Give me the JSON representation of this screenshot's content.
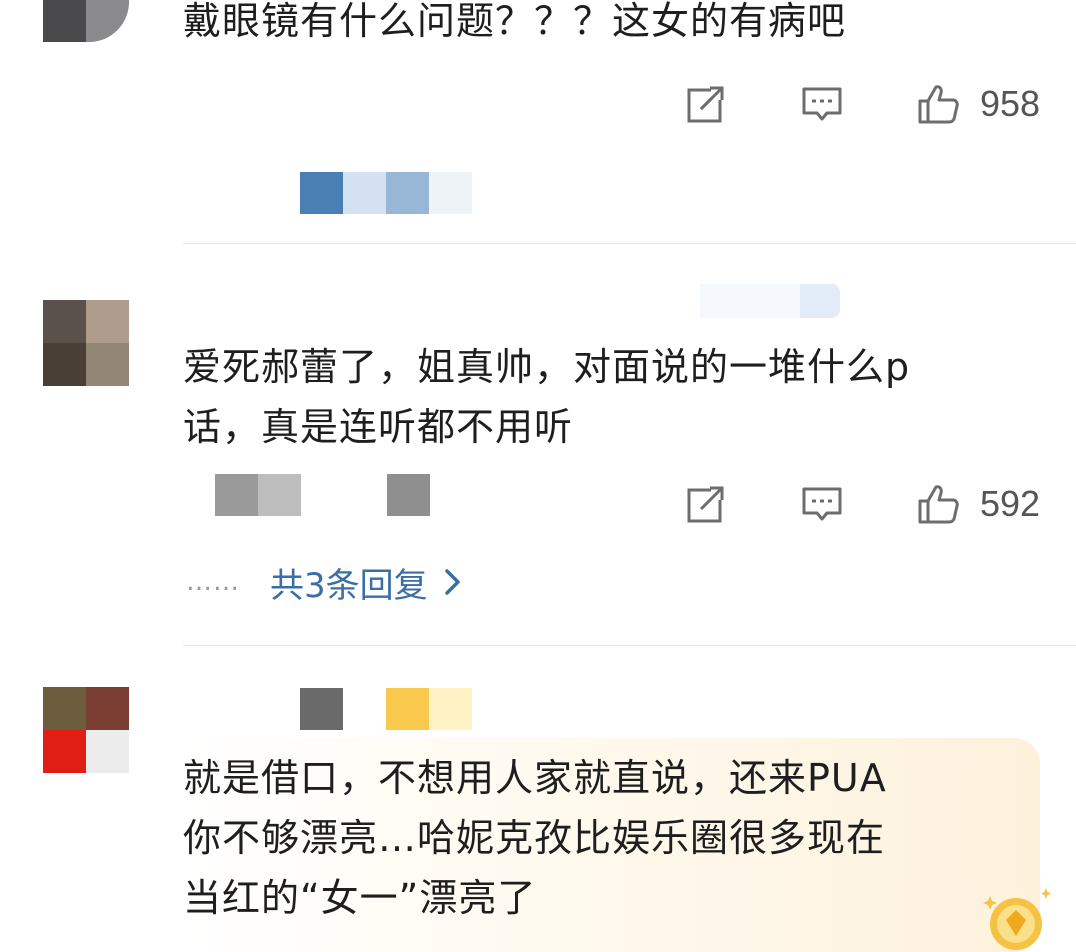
{
  "comments": [
    {
      "text": "戴眼镜有什么问题？？？这女的有病吧",
      "likes": "958"
    },
    {
      "text_line1": "爱死郝蕾了，姐真帅，对面说的一堆什么p",
      "text_line2": "话，真是连听都不用听",
      "likes": "592",
      "replies": {
        "dots": "……",
        "label": "共3条回复"
      }
    },
    {
      "text_line1": "就是借口，不想用人家就直说，还来PUA",
      "text_line2": "你不够漂亮…哈妮克孜比娱乐圈很多现在",
      "text_line3": "当红的“女一”漂亮了"
    }
  ],
  "colors": {
    "text": "#1e1e1e",
    "meta": "#555555",
    "link": "#3a6ea5",
    "divider": "#e8e8e8",
    "highlight": "#fdf1dc"
  },
  "icons": [
    "share-icon",
    "comment-icon",
    "like-icon",
    "chevron-right-icon",
    "gold-badge-icon"
  ]
}
